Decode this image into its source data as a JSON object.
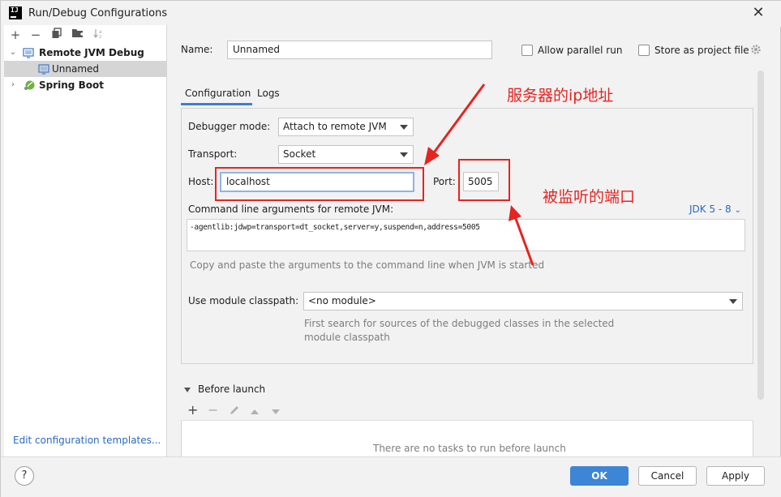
{
  "window": {
    "title": "Run/Debug Configurations",
    "app_icon_text": "IJ"
  },
  "left_toolbar": {
    "icons": [
      "add-icon",
      "remove-icon",
      "copy-icon",
      "folder-icon",
      "sort-icon"
    ]
  },
  "tree": {
    "items": [
      {
        "label": "Remote JVM Debug",
        "expanded": true,
        "bold": true
      },
      {
        "label": "Unnamed",
        "selected": true
      },
      {
        "label": "Spring Boot",
        "expanded": false,
        "bold": true
      }
    ]
  },
  "edit_templates_link": "Edit configuration templates...",
  "header": {
    "name_label": "Name:",
    "name_value": "Unnamed",
    "allow_parallel_label": "Allow parallel run",
    "store_as_project_label": "Store as project file"
  },
  "tabs": [
    {
      "label": "Configuration",
      "active": true
    },
    {
      "label": "Logs",
      "active": false
    }
  ],
  "config": {
    "debugger_mode_label": "Debugger mode:",
    "debugger_mode_value": "Attach to remote JVM",
    "transport_label": "Transport:",
    "transport_value": "Socket",
    "host_label": "Host:",
    "host_value": "localhost",
    "port_label": "Port:",
    "port_value": "5005",
    "cmdline_label": "Command line arguments for remote JVM:",
    "jdk_link": "JDK 5 - 8",
    "cmdline_value": "-agentlib:jdwp=transport=dt_socket,server=y,suspend=n,address=5005",
    "cmdline_hint": "Copy and paste the arguments to the command line when JVM is started",
    "module_label": "Use module classpath:",
    "module_value": "<no module>",
    "module_hint_line1": "First search for sources of the debugged classes in the selected",
    "module_hint_line2": "module classpath"
  },
  "before_launch": {
    "title": "Before launch",
    "empty_text": "There are no tasks to run before launch"
  },
  "buttons": {
    "help": "?",
    "ok": "OK",
    "cancel": "Cancel",
    "apply": "Apply"
  },
  "annotations": {
    "host_note": "服务器的ip地址",
    "port_note": "被监听的端口",
    "color": "#e52421"
  },
  "colors": {
    "accent": "#3d85d6",
    "link": "#2a6bbd",
    "selection": "#d5d5d5"
  }
}
